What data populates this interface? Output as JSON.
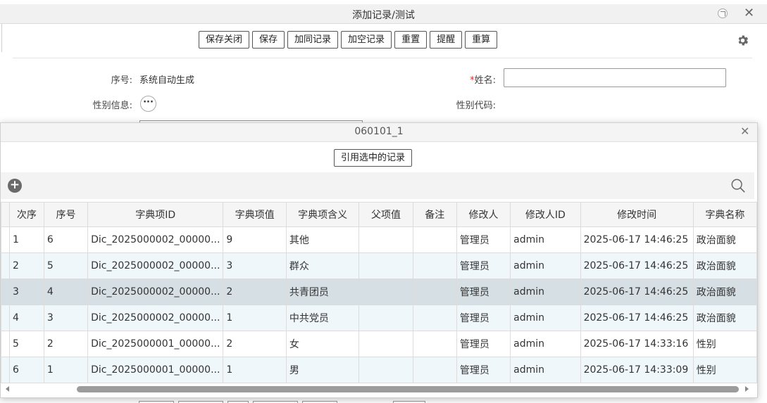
{
  "back_window": {
    "title": "添加记录/测试",
    "toolbar": {
      "save_close": "保存关闭",
      "save": "保存",
      "add_same": "加同记录",
      "add_empty": "加空记录",
      "reset": "重置",
      "remind": "提醒",
      "recalc": "重算"
    },
    "form": {
      "serial_label": "序号:",
      "serial_value": "系统自动生成",
      "name_required": "*",
      "name_label": "姓名:",
      "name_value": "",
      "gender_info_label": "性别信息:",
      "gender_info_button": "···",
      "gender_code_label": "性别代码:"
    }
  },
  "dialog": {
    "title": "060101_1",
    "reference_button": "引用选中的记录",
    "columns": [
      "次序",
      "序号",
      "字典项ID",
      "字典项值",
      "字典项含义",
      "父项值",
      "备注",
      "修改人",
      "修改人ID",
      "修改时间",
      "字典名称"
    ],
    "rows": [
      {
        "order": "1",
        "serial": "6",
        "id": "Dic_2025000002_00000...",
        "value": "9",
        "meaning": "其他",
        "parent": "",
        "note": "",
        "modifier": "管理员",
        "modifier_id": "admin",
        "time": "2025-06-17 14:46:25",
        "dict_name": "政治面貌"
      },
      {
        "order": "2",
        "serial": "5",
        "id": "Dic_2025000002_00000...",
        "value": "3",
        "meaning": "群众",
        "parent": "",
        "note": "",
        "modifier": "管理员",
        "modifier_id": "admin",
        "time": "2025-06-17 14:46:25",
        "dict_name": "政治面貌"
      },
      {
        "order": "3",
        "serial": "4",
        "id": "Dic_2025000002_00000...",
        "value": "2",
        "meaning": "共青团员",
        "parent": "",
        "note": "",
        "modifier": "管理员",
        "modifier_id": "admin",
        "time": "2025-06-17 14:46:25",
        "dict_name": "政治面貌"
      },
      {
        "order": "4",
        "serial": "3",
        "id": "Dic_2025000002_00000...",
        "value": "1",
        "meaning": "中共党员",
        "parent": "",
        "note": "",
        "modifier": "管理员",
        "modifier_id": "admin",
        "time": "2025-06-17 14:46:25",
        "dict_name": "政治面貌"
      },
      {
        "order": "5",
        "serial": "2",
        "id": "Dic_2025000001_00000...",
        "value": "2",
        "meaning": "女",
        "parent": "",
        "note": "",
        "modifier": "管理员",
        "modifier_id": "admin",
        "time": "2025-06-17 14:33:16",
        "dict_name": "性别"
      },
      {
        "order": "6",
        "serial": "1",
        "id": "Dic_2025000001_00000...",
        "value": "1",
        "meaning": "男",
        "parent": "",
        "note": "",
        "modifier": "管理员",
        "modifier_id": "admin",
        "time": "2025-06-17 14:33:09",
        "dict_name": "性别"
      }
    ],
    "selected_row": 3
  },
  "colors": {
    "link": "#1a3fb5",
    "required": "#e03030",
    "selected_row": "#d6dfe3",
    "alt_row": "#f0f7fb"
  }
}
